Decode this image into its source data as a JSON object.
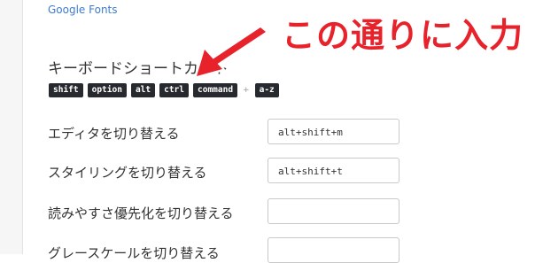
{
  "header": {
    "link_label": "Google Fonts"
  },
  "shortcuts": {
    "title": "キーボードショートカット",
    "keys": [
      "shift",
      "option",
      "alt",
      "ctrl",
      "command"
    ],
    "plus": "+",
    "range_key": "a-z"
  },
  "settings": [
    {
      "label": "エディタを切り替える",
      "value": "alt+shift+m"
    },
    {
      "label": "スタイリングを切り替える",
      "value": "alt+shift+t"
    },
    {
      "label": "読みやすさ優先化を切り替える",
      "value": ""
    },
    {
      "label": "グレースケールを切り替える",
      "value": ""
    }
  ],
  "annotation": {
    "text": "この通りに入力",
    "color": "#e8222b",
    "arrow_icon": "red-arrow-icon"
  }
}
